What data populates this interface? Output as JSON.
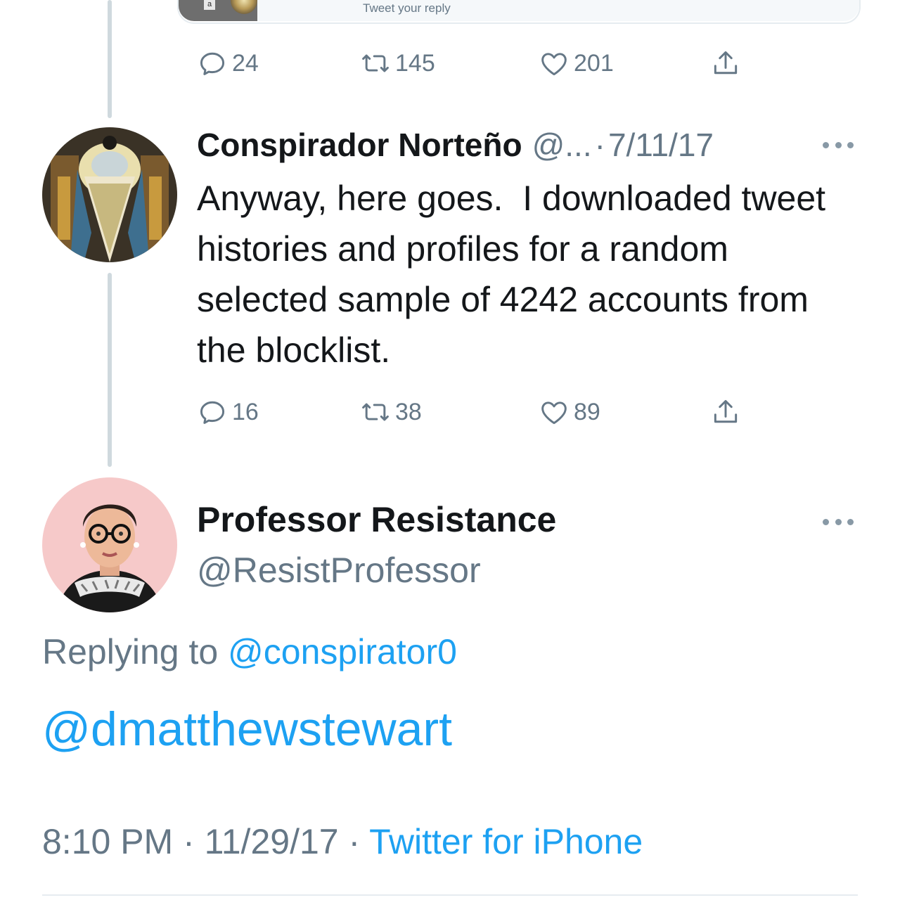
{
  "composer": {
    "thumb_letter": "a",
    "placeholder": "Tweet your reply"
  },
  "colors": {
    "link": "#1da1f2",
    "secondary_text": "#657786",
    "primary_text": "#14171a"
  },
  "parent_actions": {
    "replies": "24",
    "retweets": "145",
    "likes": "201"
  },
  "tweet1": {
    "name": "Conspirador Norteño",
    "handle": "@...",
    "separator": "·",
    "date": "7/11/17",
    "text": "Anyway, here goes.  I downloaded tweet histories and profiles for a random selected sample of 4242 accounts from the blocklist.",
    "replies": "16",
    "retweets": "38",
    "likes": "89"
  },
  "tweet2": {
    "name": "Professor Resistance",
    "handle": "@ResistProfessor",
    "replying_prefix": "Replying to ",
    "replying_mention": "@conspirator0",
    "body": "@dmatthewstewart",
    "time": "8:10 PM",
    "separator": " · ",
    "date": "11/29/17",
    "source": "Twitter for iPhone"
  },
  "icons": {
    "reply": "reply-bubble-icon",
    "retweet": "retweet-icon",
    "like": "heart-icon",
    "share": "share-upload-icon",
    "more": "more-dots-icon"
  }
}
